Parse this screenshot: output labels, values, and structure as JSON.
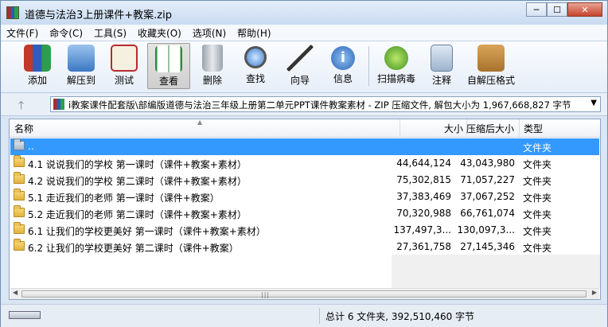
{
  "window": {
    "title": "道德与法治3上册课件+教案.zip",
    "controls": {
      "minimize": "─",
      "maximize": "☐",
      "close": "✕"
    }
  },
  "menu": [
    "文件(F)",
    "命令(C)",
    "工具(S)",
    "收藏夹(O)",
    "选项(N)",
    "帮助(H)"
  ],
  "toolbar": [
    {
      "label": "添加",
      "icon": "add-archive-icon"
    },
    {
      "label": "解压到",
      "icon": "extract-to-icon"
    },
    {
      "label": "测试",
      "icon": "test-icon"
    },
    {
      "label": "查看",
      "icon": "view-book-icon"
    },
    {
      "label": "删除",
      "icon": "delete-trash-icon"
    },
    {
      "label": "查找",
      "icon": "find-magnifier-icon"
    },
    {
      "label": "向导",
      "icon": "wizard-wand-icon"
    },
    {
      "label": "信息",
      "icon": "info-icon"
    },
    {
      "label": "扫描病毒",
      "icon": "virus-scan-icon"
    },
    {
      "label": "注释",
      "icon": "comment-icon"
    },
    {
      "label": "自解压格式",
      "icon": "sfx-archive-icon"
    }
  ],
  "address": {
    "path": "i教案课件配套版\\部编版道德与法治三年级上册第二单元PPT课件教案素材 - ZIP 压缩文件, 解包大小为 1,967,668,827 字节"
  },
  "columns": {
    "name": "名称",
    "size": "大小",
    "packed": "压缩后大小",
    "type": "类型"
  },
  "files": [
    {
      "name": "..",
      "size": "",
      "packed": "",
      "type": "文件夹",
      "up": true
    },
    {
      "name": "4.1 说说我们的学校 第一课时（课件+教案+素材）",
      "size": "44,644,124",
      "packed": "43,043,980",
      "type": "文件夹"
    },
    {
      "name": "4.2 说说我们的学校 第二课时（课件+教案+素材）",
      "size": "75,302,815",
      "packed": "71,057,227",
      "type": "文件夹"
    },
    {
      "name": "5.1 走近我们的老师 第一课时（课件+教案）",
      "size": "37,383,469",
      "packed": "37,067,252",
      "type": "文件夹"
    },
    {
      "name": "5.2 走近我们的老师 第二课时（课件+教案+素材）",
      "size": "70,320,988",
      "packed": "66,761,074",
      "type": "文件夹"
    },
    {
      "name": "6.1 让我们的学校更美好 第一课时（课件+教案+素材）",
      "size": "137,497,3...",
      "packed": "130,097,3...",
      "type": "文件夹"
    },
    {
      "name": "6.2 让我们的学校更美好 第二课时（课件+教案）",
      "size": "27,361,758",
      "packed": "27,145,346",
      "type": "文件夹"
    }
  ],
  "status": {
    "summary": "总计 6 文件夹, 392,510,460 字节"
  },
  "colors": {
    "selection": "#3399ff",
    "type_text": "#000000"
  }
}
